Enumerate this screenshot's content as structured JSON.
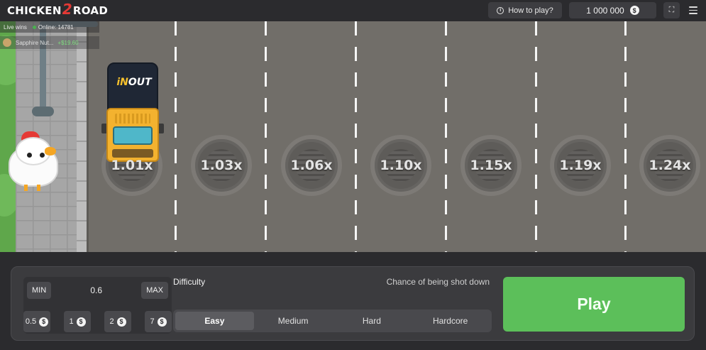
{
  "header": {
    "logo_left": "CHICKEN",
    "logo_mid": "2",
    "logo_right": "ROAD",
    "how_to_play": "How to play?",
    "balance": "1 000 000",
    "currency_icon": "dollar-coin-icon"
  },
  "live": {
    "label": "Live wins",
    "online": "Online: 14781",
    "recent_win_user": "Sapphire Nut...",
    "recent_win_amount": "+$19.60"
  },
  "truck": {
    "logo_i": "iN",
    "logo_rest": "OUT"
  },
  "lanes": [
    {
      "multiplier": "1.01x"
    },
    {
      "multiplier": "1.03x"
    },
    {
      "multiplier": "1.06x"
    },
    {
      "multiplier": "1.10x"
    },
    {
      "multiplier": "1.15x"
    },
    {
      "multiplier": "1.19x"
    },
    {
      "multiplier": "1.24x"
    }
  ],
  "bet": {
    "min_label": "MIN",
    "value": "0.6",
    "max_label": "MAX",
    "quick": [
      "0.5",
      "1",
      "2",
      "7"
    ]
  },
  "difficulty": {
    "label": "Difficulty",
    "chance_label": "Chance of being shot down",
    "options": [
      "Easy",
      "Medium",
      "Hard",
      "Hardcore"
    ],
    "selected": "Easy"
  },
  "play_label": "Play",
  "colors": {
    "background": "#2b2b2e",
    "road": "#716e69",
    "play": "#5cbf5a",
    "panel": "#3b3b3e"
  }
}
